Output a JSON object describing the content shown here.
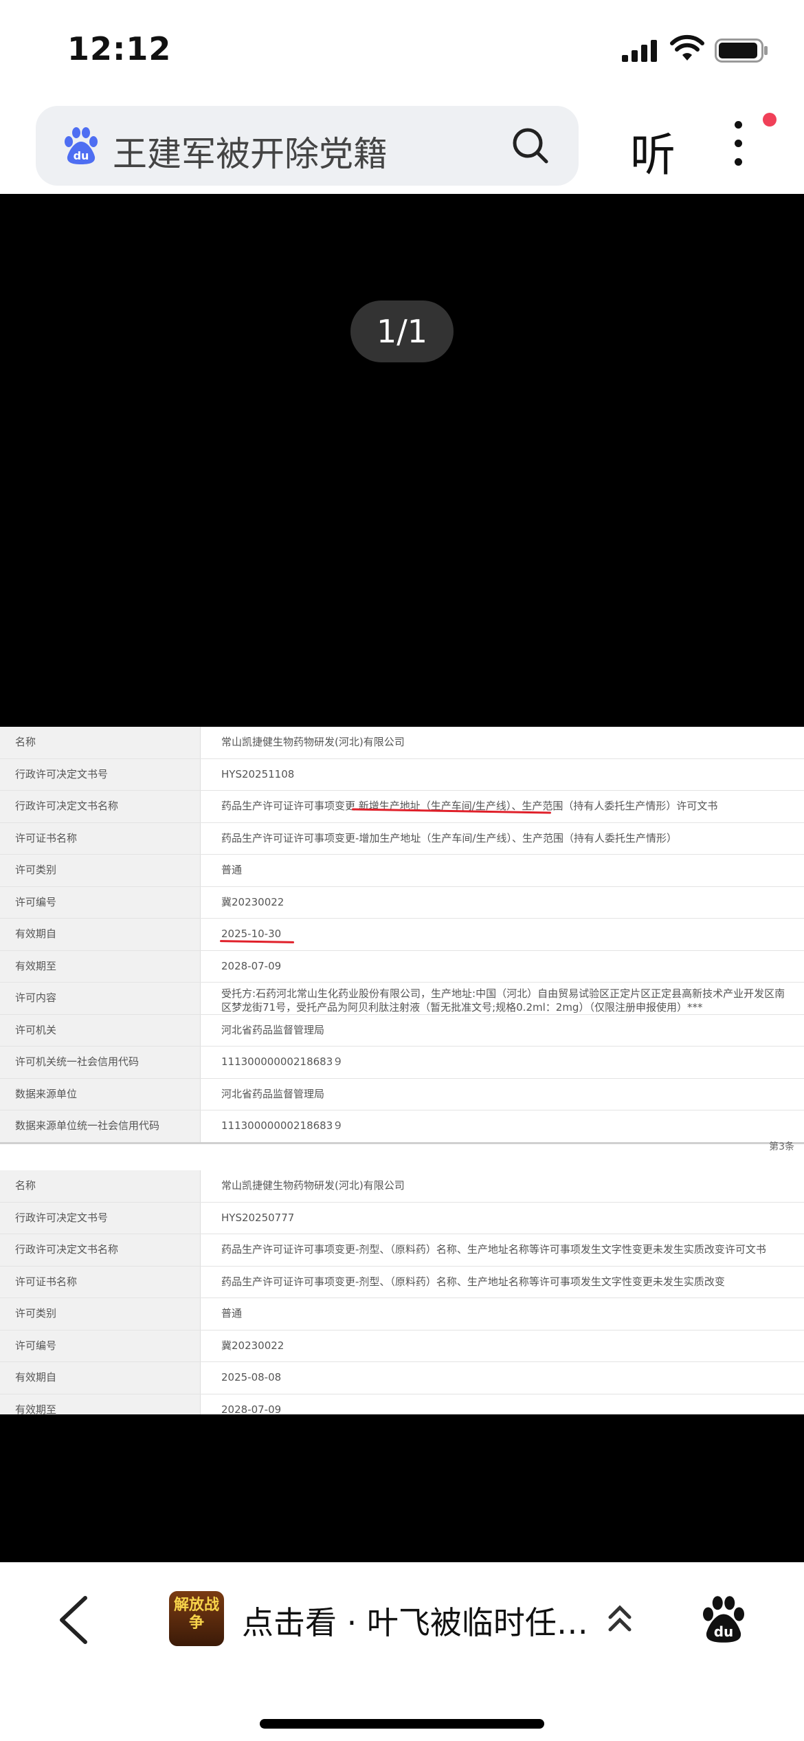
{
  "status_bar": {
    "time": "12:12"
  },
  "search": {
    "query": "王建军被开除党籍"
  },
  "header": {
    "listen_label": "听"
  },
  "viewer": {
    "counter": "1/1"
  },
  "document": {
    "table1": [
      {
        "label": "名称",
        "value": "常山凯捷健生物药物研发(河北)有限公司"
      },
      {
        "label": "行政许可决定文书号",
        "value": "HYS20251108"
      },
      {
        "label": "行政许可决定文书名称",
        "value": "药品生产许可证许可事项变更  新增生产地址（生产车间/生产线）、生产范围（持有人委托生产情形）许可文书"
      },
      {
        "label": "许可证书名称",
        "value": "药品生产许可证许可事项变更-增加生产地址（生产车间/生产线）、生产范围（持有人委托生产情形）"
      },
      {
        "label": "许可类别",
        "value": "普通"
      },
      {
        "label": "许可编号",
        "value": "冀20230022"
      },
      {
        "label": "有效期自",
        "value": "2025-10-30"
      },
      {
        "label": "有效期至",
        "value": "2028-07-09"
      },
      {
        "label": "许可内容",
        "value": "受托方:石药河北常山生化药业股份有限公司，生产地址:中国（河北）自由贸易试验区正定片区正定县高新技术产业开发区南区梦龙街71号，受托产品为阿贝利肽注射液（暂无批准文号;规格0.2ml：2mg）（仅限注册申报使用）***"
      },
      {
        "label": "许可机关",
        "value": "河北省药品监督管理局"
      },
      {
        "label": "许可机关统一社会信用代码",
        "value": "11130000000218683９"
      },
      {
        "label": "数据来源单位",
        "value": "河北省药品监督管理局"
      },
      {
        "label": "数据来源单位统一社会信用代码",
        "value": "11130000000218683９"
      }
    ],
    "page_no": "第3条",
    "table2": [
      {
        "label": "名称",
        "value": "常山凯捷健生物药物研发(河北)有限公司"
      },
      {
        "label": "行政许可决定文书号",
        "value": "HYS20250777"
      },
      {
        "label": "行政许可决定文书名称",
        "value": "药品生产许可证许可事项变更-剂型、（原料药）名称、生产地址名称等许可事项发生文字性变更未发生实质改变许可文书"
      },
      {
        "label": "许可证书名称",
        "value": "药品生产许可证许可事项变更-剂型、（原料药）名称、生产地址名称等许可事项发生文字性变更未发生实质改变"
      },
      {
        "label": "许可类别",
        "value": "普通"
      },
      {
        "label": "许可编号",
        "value": "冀20230022"
      },
      {
        "label": "有效期自",
        "value": "2025-08-08"
      },
      {
        "label": "有效期至",
        "value": "2028-07-09"
      }
    ]
  },
  "bottom_bar": {
    "thumb_text": "解放战争",
    "caption": "点击看 · 叶飞被临时任…"
  },
  "colors": {
    "accent_red": "#e0202a",
    "badge_red": "#f04058",
    "baidu_blue": "#4e6ef2"
  }
}
